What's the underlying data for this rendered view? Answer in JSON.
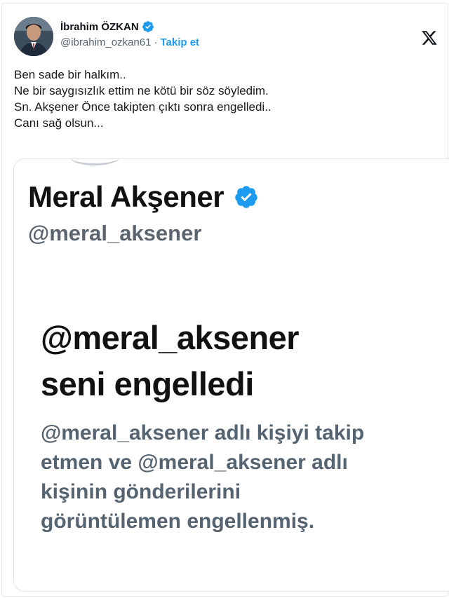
{
  "author": {
    "name": "İbrahim ÖZKAN",
    "handle": "@ibrahim_ozkan61",
    "separator": "·",
    "follow_label": "Takip et",
    "verified_icon": "verified-badge-icon",
    "avatar_icon": "avatar"
  },
  "platform_logo": "x-logo-icon",
  "tweet": {
    "lines": [
      "Ben sade bir halkım..",
      "Ne bir saygısızlık ettim ne kötü bir söz söyledim.",
      "Sn. Akşener Önce takipten çıktı sonra engelledi..",
      "Canı sağ olsun..."
    ]
  },
  "media": {
    "profile_name": "Meral Akşener",
    "profile_handle": "@meral_aksener",
    "blocked_title_lines": [
      "@meral_aksener",
      "seni engelledi"
    ],
    "blocked_desc_lines": [
      "@meral_aksener adlı kişiyi takip",
      "etmen ve @meral_aksener adlı",
      "kişinin gönderilerini",
      "görüntülemen engellenmiş."
    ]
  },
  "colors": {
    "verified_blue": "#1d9bf0",
    "link_blue": "#1d9bf0",
    "muted_text": "#536471"
  }
}
